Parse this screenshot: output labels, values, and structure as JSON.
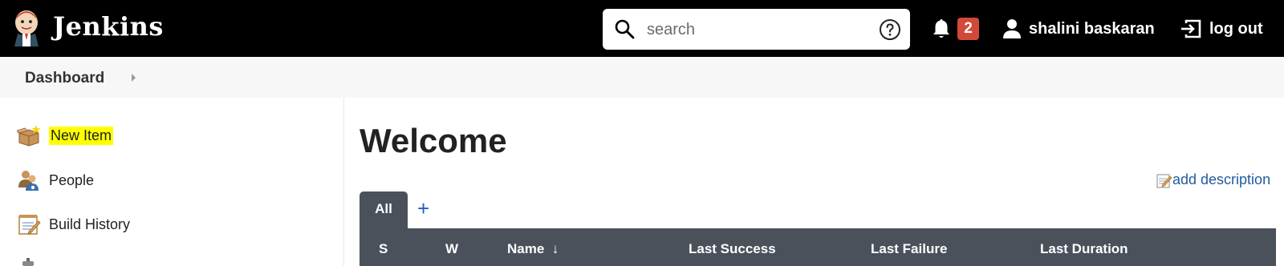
{
  "header": {
    "brand": "Jenkins",
    "search_placeholder": "search",
    "notification_count": "2",
    "user_name": "shalini baskaran",
    "logout_label": "log out",
    "colors": {
      "background": "#000000",
      "badge": "#d24939"
    }
  },
  "breadcrumb": {
    "items": [
      {
        "label": "Dashboard"
      }
    ]
  },
  "sidebar": {
    "items": [
      {
        "label": "New Item",
        "icon": "package-icon",
        "highlighted": true
      },
      {
        "label": "People",
        "icon": "people-icon"
      },
      {
        "label": "Build History",
        "icon": "notepad-icon"
      }
    ]
  },
  "main": {
    "title": "Welcome",
    "add_description_label": "add description",
    "tabs": [
      {
        "label": "All",
        "active": true
      }
    ],
    "add_tab_label": "+",
    "table": {
      "columns": [
        "S",
        "W",
        "Name  ↓",
        "Last Success",
        "Last Failure",
        "Last Duration"
      ]
    }
  }
}
